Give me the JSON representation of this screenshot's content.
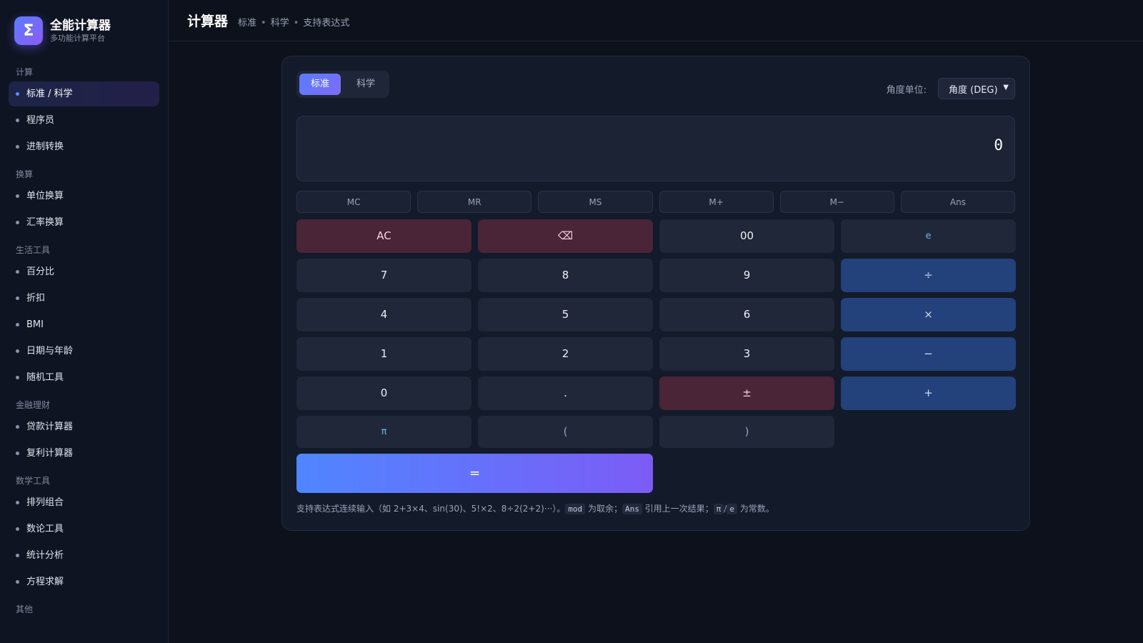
{
  "brand": {
    "logo": "Σ",
    "title": "全能计算器",
    "subtitle": "多功能计算平台"
  },
  "sidebar": {
    "groups": [
      {
        "label": "计算",
        "items": [
          {
            "label": "标准 / 科学",
            "active": true
          },
          {
            "label": "程序员"
          },
          {
            "label": "进制转换"
          }
        ]
      },
      {
        "label": "换算",
        "items": [
          {
            "label": "单位换算"
          },
          {
            "label": "汇率换算"
          }
        ]
      },
      {
        "label": "生活工具",
        "items": [
          {
            "label": "百分比"
          },
          {
            "label": "折扣"
          },
          {
            "label": "BMI"
          },
          {
            "label": "日期与年龄"
          },
          {
            "label": "随机工具"
          }
        ]
      },
      {
        "label": "金融理财",
        "items": [
          {
            "label": "贷款计算器"
          },
          {
            "label": "复利计算器"
          }
        ]
      },
      {
        "label": "数学工具",
        "items": [
          {
            "label": "排列组合"
          },
          {
            "label": "数论工具"
          },
          {
            "label": "统计分析"
          },
          {
            "label": "方程求解"
          }
        ]
      },
      {
        "label": "其他",
        "items": []
      }
    ]
  },
  "header": {
    "title": "计算器",
    "crumbs": [
      "标准",
      "科学",
      "支持表达式"
    ],
    "separator": "•"
  },
  "tabs": [
    {
      "label": "标准",
      "active": true
    },
    {
      "label": "科学"
    }
  ],
  "angle": {
    "label": "角度单位:",
    "selected": "角度 (DEG)"
  },
  "display": {
    "value": "0"
  },
  "memory": [
    "MC",
    "MR",
    "MS",
    "M+",
    "M−",
    "Ans"
  ],
  "keys": {
    "row1": [
      "AC",
      "⌫",
      "00",
      "e"
    ],
    "row2": [
      "7",
      "8",
      "9",
      "÷"
    ],
    "row3": [
      "4",
      "5",
      "6",
      "×"
    ],
    "row4": [
      "1",
      "2",
      "3",
      "−"
    ],
    "row5": [
      "0",
      ".",
      "±",
      "+"
    ],
    "row6": [
      "π",
      "(",
      ")"
    ],
    "equals": "="
  },
  "hint": {
    "part1": "支持表达式连续输入（如 2+3×4、sin(30)、5!×2、8÷2(2+2)···）。",
    "code_mod": "mod",
    "part2": " 为取余；",
    "code_ans": "Ans",
    "part3": " 引用上一次结果；",
    "code_pi": "π",
    "slash": "/",
    "code_e": "e",
    "part4": " 为常数。"
  }
}
